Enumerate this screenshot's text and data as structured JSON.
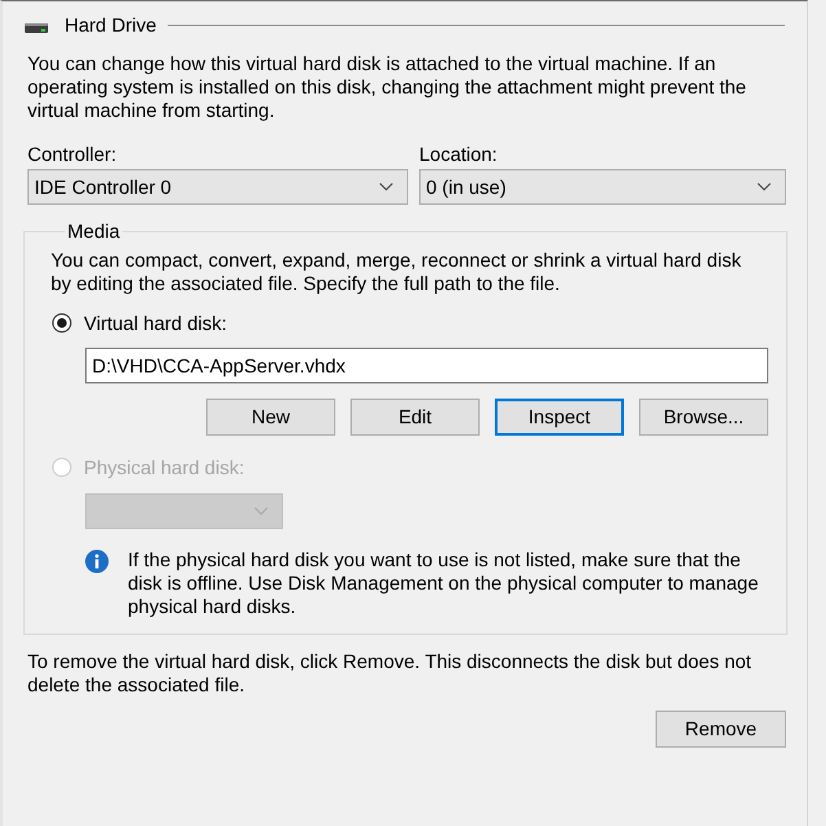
{
  "section": {
    "title": "Hard Drive",
    "description": "You can change how this virtual hard disk is attached to the virtual machine. If an operating system is installed on this disk, changing the attachment might prevent the virtual machine from starting."
  },
  "controller": {
    "label": "Controller:",
    "value": "IDE Controller 0"
  },
  "location": {
    "label": "Location:",
    "value": "0 (in use)"
  },
  "media": {
    "title": "Media",
    "description": "You can compact, convert, expand, merge, reconnect or shrink a virtual hard disk by editing the associated file. Specify the full path to the file.",
    "options": [
      {
        "label": "Virtual hard disk:",
        "selected": true,
        "disabled": false
      },
      {
        "label": "Physical hard disk:",
        "selected": false,
        "disabled": true
      }
    ],
    "path": {
      "value": "D:\\VHD\\CCA-AppServer.vhdx"
    },
    "buttons": [
      {
        "label": "New",
        "focused": false
      },
      {
        "label": "Edit",
        "focused": false
      },
      {
        "label": "Inspect",
        "focused": true
      },
      {
        "label": "Browse...",
        "focused": false
      }
    ],
    "physical_disk": {
      "disabled": true
    },
    "info": "If the physical hard disk you want to use is not listed, make sure that the disk is offline. Use Disk Management on the physical computer to manage physical hard disks."
  },
  "remove": {
    "description": "To remove the virtual hard disk, click Remove. This disconnects the disk but does not delete the associated file.",
    "button": "Remove"
  }
}
